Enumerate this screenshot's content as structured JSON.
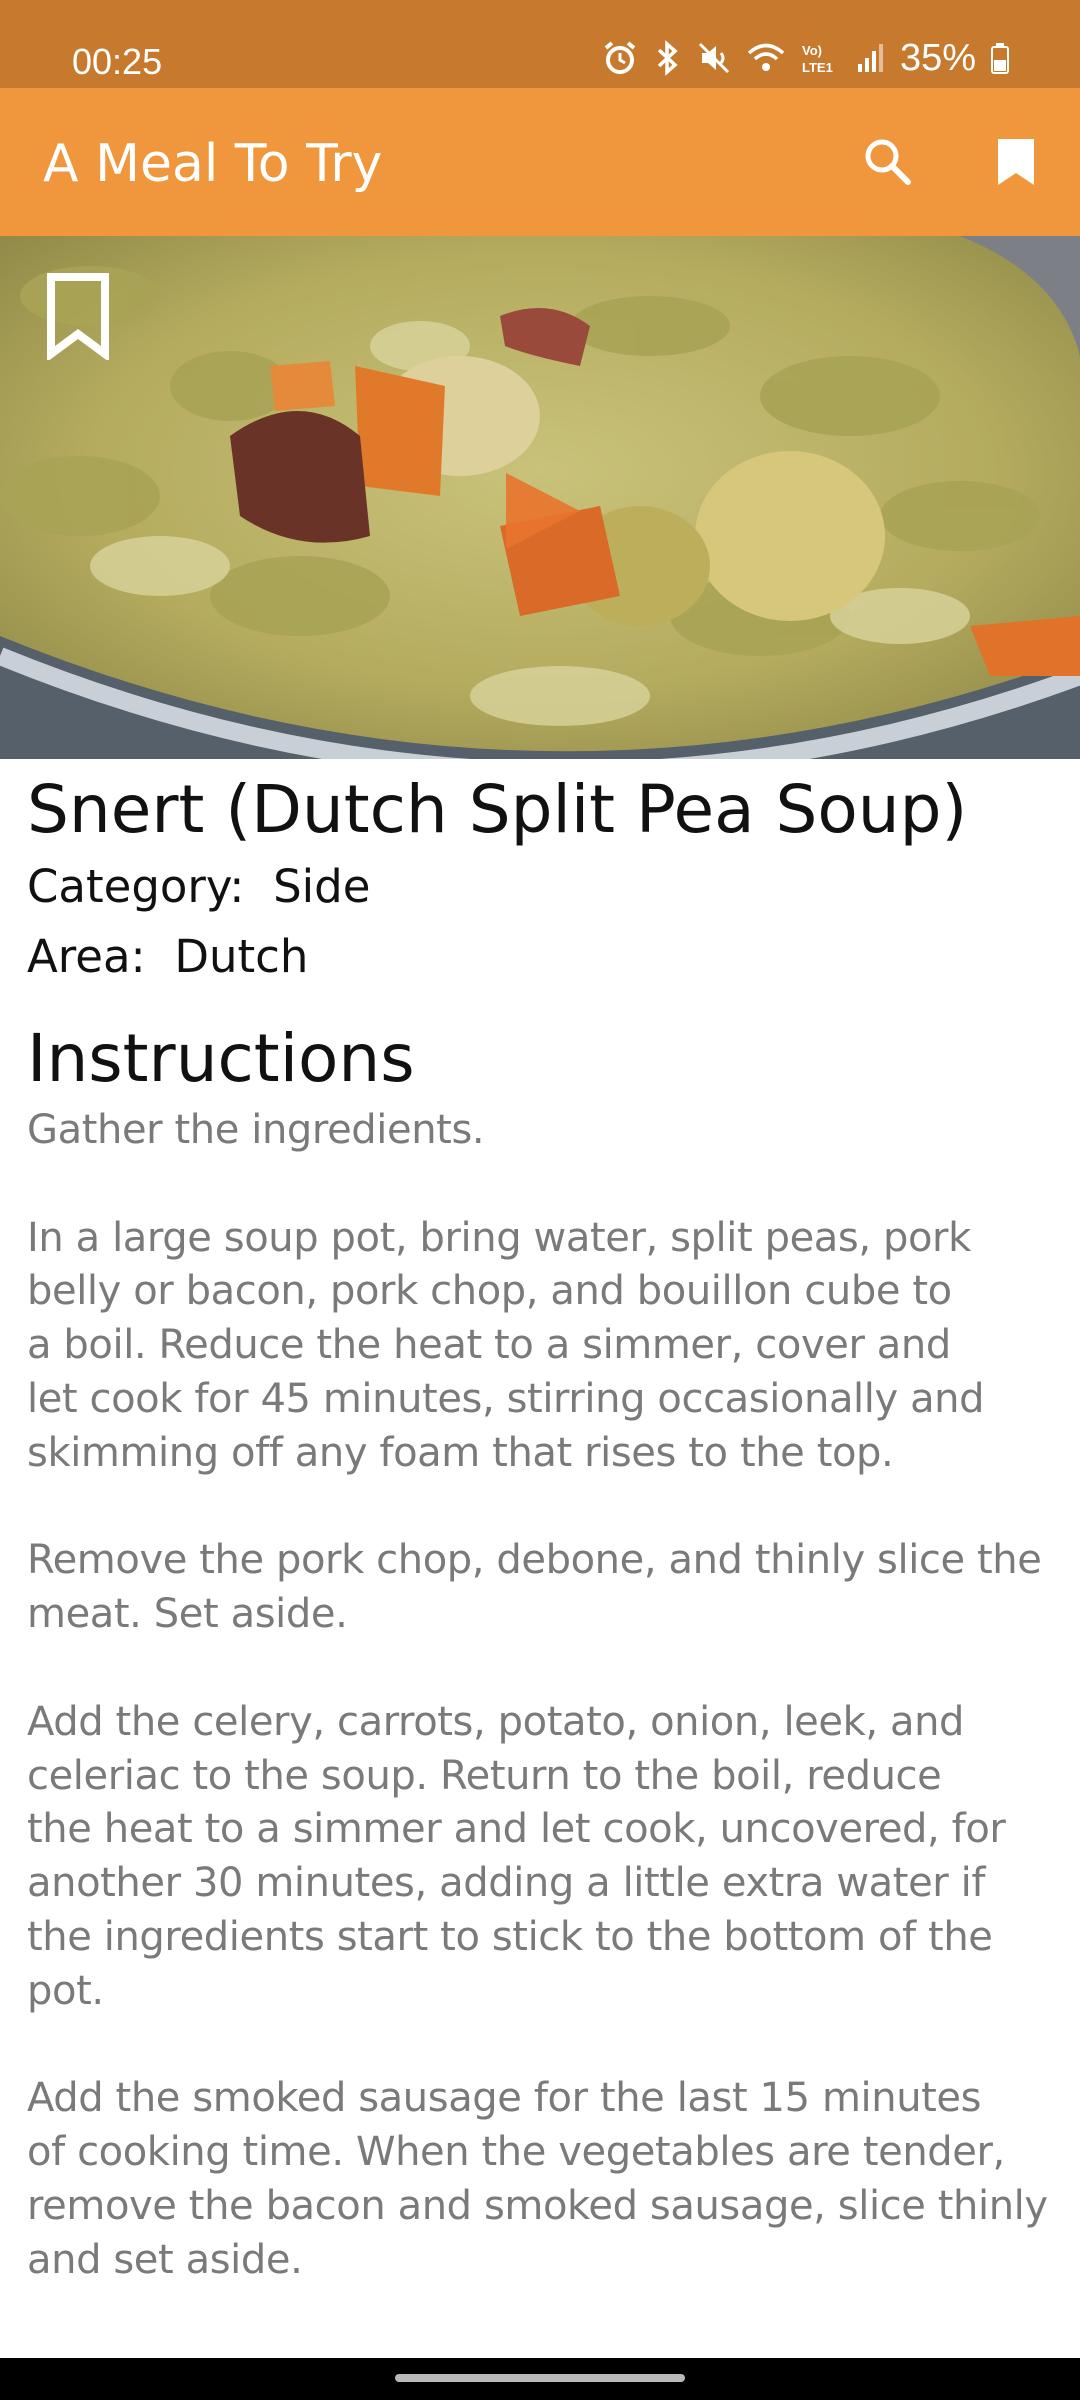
{
  "status_bar": {
    "time": "00:25",
    "network_label": "Vo) LTE1",
    "battery": "35%"
  },
  "app_bar": {
    "title": "A Meal To Try",
    "icons": [
      "search-icon",
      "bookmark-icon"
    ],
    "colors": {
      "status": "#c77a2e",
      "bar": "#f0963c"
    }
  },
  "hero": {
    "icons": [
      "bookmark-outline-icon",
      "play-icon"
    ],
    "play_color": "#e8742e"
  },
  "recipe": {
    "title": "Snert (Dutch Split Pea Soup)",
    "category_label": "Category:",
    "category_value": "Side",
    "area_label": "Area:",
    "area_value": "Dutch",
    "instructions_heading": "Instructions",
    "instructions": "Gather the ingredients.\n\nIn a large soup pot, bring water, split peas, pork\nbelly or bacon, pork chop, and bouillon cube to\na boil. Reduce the heat to a simmer, cover and\nlet cook for 45 minutes, stirring occasionally and\nskimming off any foam that rises to the top.\n\nRemove the pork chop, debone, and thinly slice the\nmeat. Set aside.\n\nAdd the celery, carrots, potato, onion, leek, and\nceleriac to the soup. Return to the boil, reduce\nthe heat to a simmer and let cook, uncovered, for\nanother 30 minutes, adding a little extra water if\nthe ingredients start to stick to the bottom of the\npot.\n\nAdd the smoked sausage for the last 15 minutes\nof cooking time. When the vegetables are tender,\nremove the bacon and smoked sausage, slice thinly\nand set aside."
  }
}
